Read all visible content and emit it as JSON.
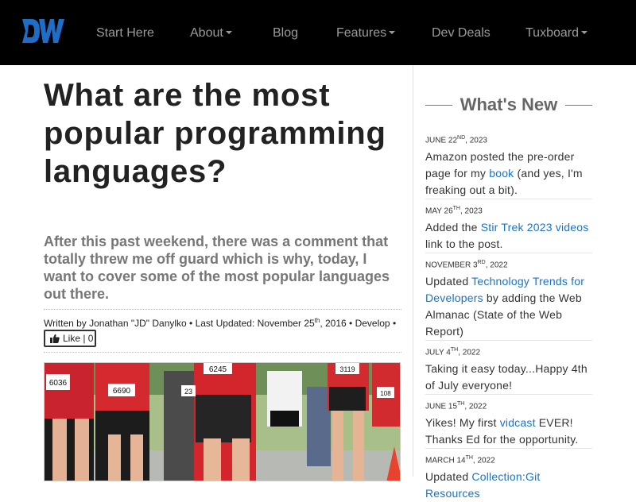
{
  "nav": {
    "logo_text": "DW",
    "items": [
      {
        "label": "Start Here",
        "caret": false
      },
      {
        "label": "About",
        "caret": true
      },
      {
        "label": "Blog",
        "caret": false
      },
      {
        "label": "Features",
        "caret": true
      },
      {
        "label": "Dev Deals",
        "caret": false
      },
      {
        "label": "Tuxboard",
        "caret": true
      }
    ]
  },
  "article": {
    "title": "What are the most popular programming languages?",
    "subtitle": "After this past weekend, there was a comment that totally threw me off guard which is why, today, I want to cover some of the most popular languages out there.",
    "byline_prefix": "Written by Jonathan \"JD\" Danylko • Last Updated: November 25",
    "byline_sup": "th",
    "byline_suffix": ", 2016 • Develop •",
    "like_label": "Like | 0",
    "image_bibs": [
      "6036",
      "6690",
      "23",
      "6245",
      "3119",
      "108"
    ]
  },
  "sidebar": {
    "title": "What's New",
    "items": [
      {
        "date_main": "June 22",
        "date_sup": "nd",
        "date_year": ", 2023",
        "segments": [
          {
            "t": "Amazon posted the pre-order page for my "
          },
          {
            "t": "book",
            "link": true
          },
          {
            "t": " (and yes, I'm freaking out a bit)."
          }
        ]
      },
      {
        "date_main": "May 26",
        "date_sup": "th",
        "date_year": ", 2023",
        "segments": [
          {
            "t": "Added the "
          },
          {
            "t": "Stir Trek 2023 videos",
            "link": true
          },
          {
            "t": " link to the post."
          }
        ]
      },
      {
        "date_main": "November 3",
        "date_sup": "rd",
        "date_year": ", 2022",
        "segments": [
          {
            "t": "Updated "
          },
          {
            "t": "Technology Trends for Developers",
            "link": true
          },
          {
            "t": " by adding the Web Almanac (State of the Web Report)"
          }
        ]
      },
      {
        "date_main": "July 4",
        "date_sup": "th",
        "date_year": ", 2022",
        "segments": [
          {
            "t": "Taking it easy today...Happy 4th of July everyone!"
          }
        ]
      },
      {
        "date_main": "June 15",
        "date_sup": "th",
        "date_year": ", 2022",
        "segments": [
          {
            "t": "Yikes! My first "
          },
          {
            "t": "vidcast",
            "link": true
          },
          {
            "t": " EVER! Thanks Ed for the opportunity."
          }
        ]
      },
      {
        "date_main": "March 14",
        "date_sup": "th",
        "date_year": ", 2022",
        "segments": [
          {
            "t": "Updated "
          },
          {
            "t": "Collection:Git Resources",
            "link": true
          }
        ]
      }
    ]
  },
  "colors": {
    "nav_bg": "#000000",
    "logo_blue": "#1e6ec8",
    "nav_text": "#9b9b9b",
    "link": "#1a73c9",
    "title_text": "#222222",
    "subtitle_text": "#777777"
  }
}
